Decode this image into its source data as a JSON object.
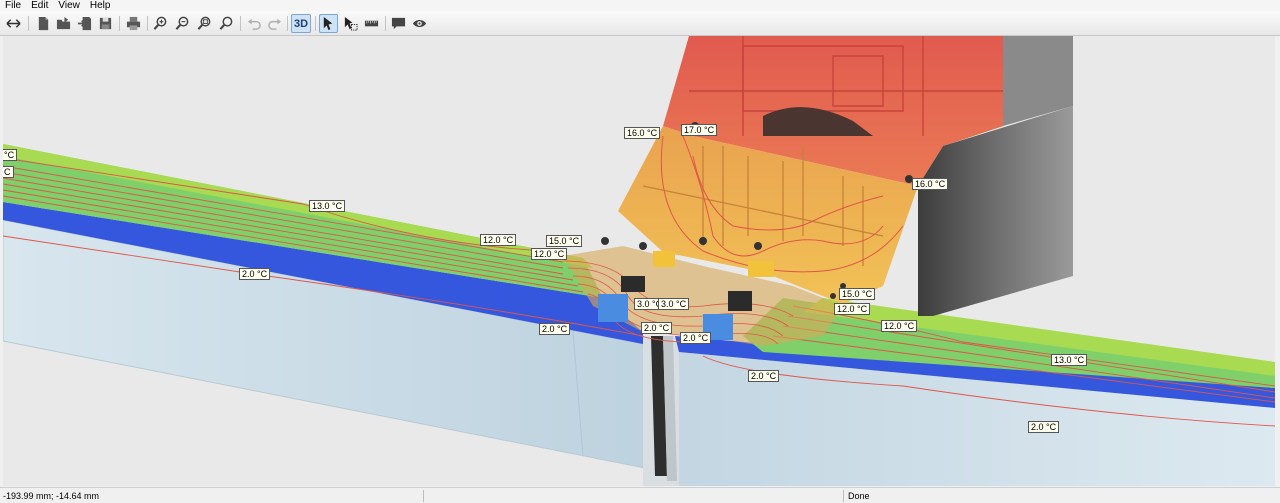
{
  "menu": [
    "File",
    "Edit",
    "View",
    "Help"
  ],
  "toolbar": {
    "tools": [
      {
        "id": "fit",
        "icon": "fit-horizontal-icon"
      },
      {
        "id": "new",
        "icon": "new-file-icon"
      },
      {
        "id": "open",
        "icon": "open-folder-icon"
      },
      {
        "id": "import",
        "icon": "import-icon"
      },
      {
        "id": "save",
        "icon": "save-icon"
      },
      {
        "id": "print",
        "icon": "print-icon"
      },
      {
        "id": "zoom-in",
        "icon": "zoom-in-icon"
      },
      {
        "id": "zoom-out",
        "icon": "zoom-out-icon"
      },
      {
        "id": "zoom-window",
        "icon": "zoom-window-icon"
      },
      {
        "id": "zoom-all",
        "icon": "zoom-all-icon"
      },
      {
        "id": "undo",
        "icon": "undo-icon"
      },
      {
        "id": "redo",
        "icon": "redo-icon"
      },
      {
        "id": "view-3d",
        "icon": "3d-view-icon",
        "label": "3D",
        "active": true
      },
      {
        "id": "select",
        "icon": "select-arrow-icon",
        "active": true
      },
      {
        "id": "select-area",
        "icon": "select-area-icon"
      },
      {
        "id": "measure",
        "icon": "ruler-icon"
      },
      {
        "id": "comment",
        "icon": "comment-icon"
      },
      {
        "id": "visibility",
        "icon": "eye-icon"
      }
    ]
  },
  "isotherm_labels": [
    {
      "id": "l-left-top-1",
      "text": "°C"
    },
    {
      "id": "l-left-top-2",
      "text": "C"
    },
    {
      "id": "l-13-left",
      "text": "13.0 °C"
    },
    {
      "id": "l-12-left",
      "text": "12.0 °C"
    },
    {
      "id": "l-2-left",
      "text": "2.0 °C"
    },
    {
      "id": "l-16-top",
      "text": "16.0 °C"
    },
    {
      "id": "l-17-top",
      "text": "17.0 °C"
    },
    {
      "id": "l-16-right",
      "text": "16.0 °C"
    },
    {
      "id": "l-15-center",
      "text": "15.0 °C"
    },
    {
      "id": "l-12-center",
      "text": "12.0 °C"
    },
    {
      "id": "l-3-a",
      "text": "3.0 °C"
    },
    {
      "id": "l-3-b",
      "text": "3.0 °C"
    },
    {
      "id": "l-2-center-a",
      "text": "2.0 °C"
    },
    {
      "id": "l-2-center-b",
      "text": "2.0 °C"
    },
    {
      "id": "l-2-center-c",
      "text": "2.0 °C"
    },
    {
      "id": "l-15-right",
      "text": "15.0 °C"
    },
    {
      "id": "l-12-right-a",
      "text": "12.0 °C"
    },
    {
      "id": "l-12-right-b",
      "text": "12.0 °C"
    },
    {
      "id": "l-13-right",
      "text": "13.0 °C"
    },
    {
      "id": "l-2-right-a",
      "text": "2.0 °C"
    },
    {
      "id": "l-2-right-b",
      "text": "2.0 °C"
    }
  ],
  "status": {
    "coordinates": "-193.99 mm; -14.64 mm",
    "state": "Done"
  },
  "colors": {
    "warm": "#e0554a",
    "mid": "#f0a84a",
    "cool": "#3a5fe0",
    "surface": "#9ed65a",
    "glass": "#c8dbe6"
  }
}
